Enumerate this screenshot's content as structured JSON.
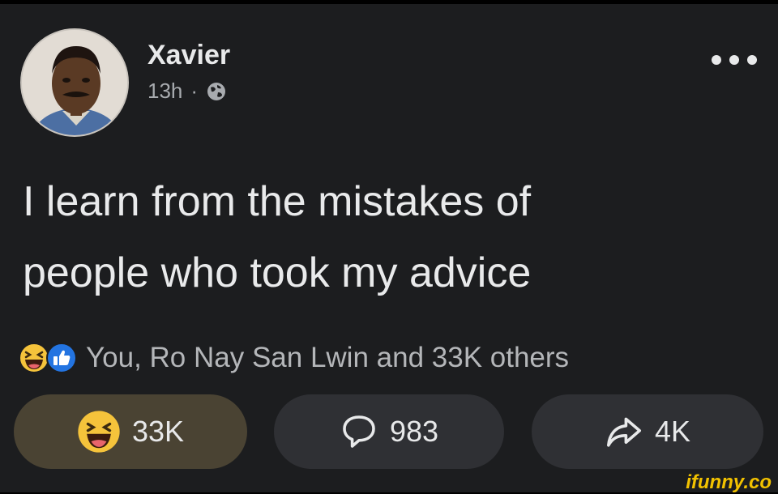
{
  "post": {
    "author": "Xavier",
    "time": "13h",
    "separator": "·",
    "audience_icon": "globe-icon",
    "text_line1": "I learn from the mistakes of",
    "text_line2": "people who took my advice",
    "reactions_summary": "You, Ro Nay San Lwin and 33K others",
    "reaction_icons": [
      "laugh-emoji-icon",
      "like-thumb-icon"
    ]
  },
  "actions": {
    "react_count": "33K",
    "comment_count": "983",
    "share_count": "4K"
  },
  "watermark": "ifunny.co",
  "colors": {
    "background": "#1c1d1f",
    "text": "#e9eaeb",
    "secondary_text": "#a8abaf",
    "reacted_button": "#4a4333",
    "button": "#2f3034",
    "like_blue": "#2374e1",
    "laugh_yellow": "#f5c33b",
    "watermark": "#f2c200"
  }
}
